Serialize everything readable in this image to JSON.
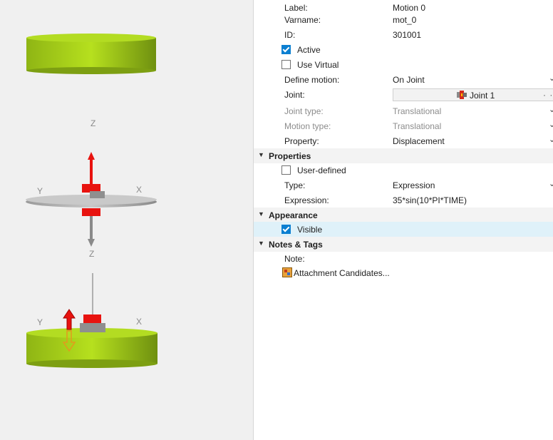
{
  "viewport": {
    "axis_labels": {
      "z": "Z",
      "y": "Y",
      "x": "X"
    }
  },
  "panel": {
    "fields": [
      {
        "label": "Label:",
        "value": "Motion 0"
      },
      {
        "label": "Varname:",
        "value": "mot_0"
      },
      {
        "label": "ID:",
        "value": "301001"
      }
    ],
    "active": {
      "label": "Active",
      "checked": true
    },
    "use_virtual": {
      "label": "Use Virtual",
      "checked": false
    },
    "define_motion": {
      "label": "Define motion:",
      "value": "On Joint"
    },
    "joint": {
      "label": "Joint:",
      "value": "Joint 1",
      "more": "· ·"
    },
    "joint_type": {
      "label": "Joint type:",
      "value": "Translational"
    },
    "motion_type": {
      "label": "Motion type:",
      "value": "Translational"
    },
    "property": {
      "label": "Property:",
      "value": "Displacement"
    },
    "sections": {
      "properties": "Properties",
      "appearance": "Appearance",
      "notes_tags": "Notes & Tags"
    },
    "user_defined": {
      "label": "User-defined",
      "checked": false
    },
    "type": {
      "label": "Type:",
      "value": "Expression"
    },
    "expression": {
      "label": "Expression:",
      "value": "35*sin(10*PI*TIME)"
    },
    "visible": {
      "label": "Visible",
      "checked": true
    },
    "note": {
      "label": "Note:"
    },
    "attachment": {
      "label": "Attachment Candidates..."
    }
  },
  "colors": {
    "body_green": "#a8d21a",
    "motion_red": "#e8130f",
    "highlight_row": "#dff1f9",
    "checkbox_blue": "#0b7fd1"
  }
}
